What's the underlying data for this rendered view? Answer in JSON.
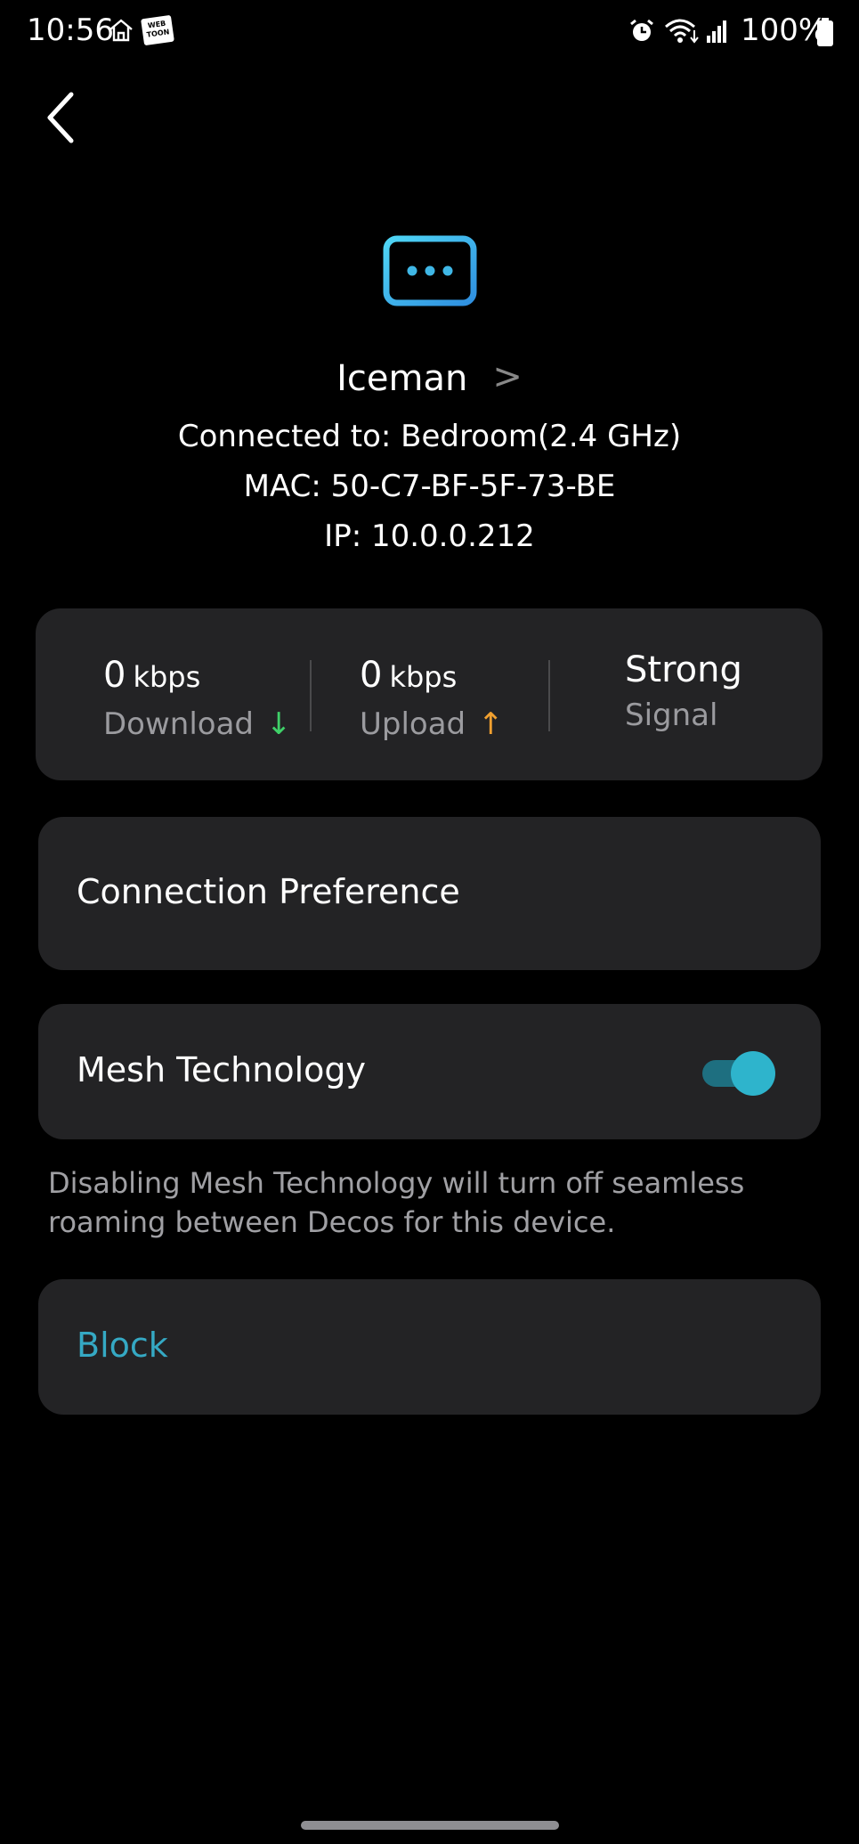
{
  "status_bar": {
    "time": "10:56",
    "battery": "100%",
    "app_badge": "WEB TOON"
  },
  "device": {
    "name": "Iceman",
    "connected_to": "Connected to: Bedroom(2.4 GHz)",
    "mac": "MAC: 50-C7-BF-5F-73-BE",
    "ip": "IP: 10.0.0.212",
    "icon": "device-more-icon",
    "accent_color": "#3fb7e6"
  },
  "stats": {
    "download": {
      "value": "0",
      "unit": "kbps",
      "label": "Download",
      "arrow": "↓"
    },
    "upload": {
      "value": "0",
      "unit": "kbps",
      "label": "Upload",
      "arrow": "↑"
    },
    "signal": {
      "value": "Strong",
      "label": "Signal"
    }
  },
  "connection_preference": {
    "label": "Connection Preference"
  },
  "mesh": {
    "label": "Mesh Technology",
    "enabled": true,
    "note": "Disabling Mesh Technology will turn off seamless roaming between Decos for this device.",
    "toggle_color": "#2eb4cc"
  },
  "block": {
    "label": "Block",
    "color": "#35a9c4"
  }
}
